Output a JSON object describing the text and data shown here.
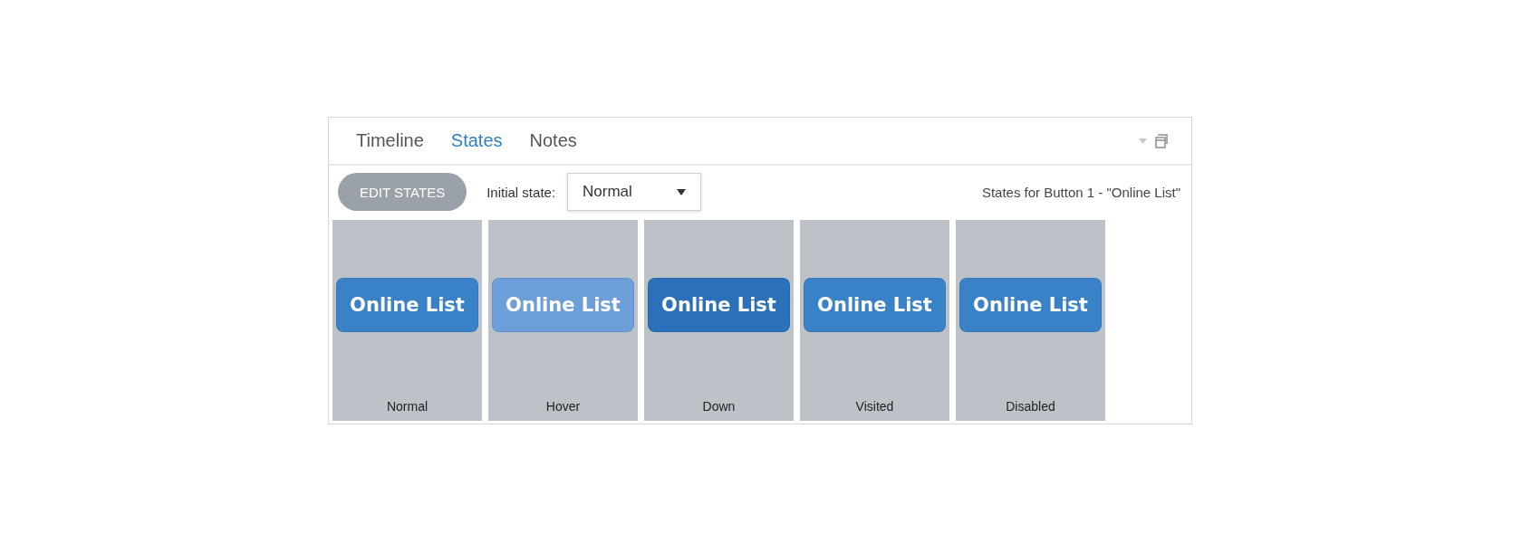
{
  "tabs": [
    {
      "label": "Timeline",
      "selected": false
    },
    {
      "label": "States",
      "selected": true
    },
    {
      "label": "Notes",
      "selected": false
    }
  ],
  "toolbar": {
    "edit_button": "EDIT STATES",
    "initial_state_label": "Initial state:",
    "initial_state_value": "Normal",
    "caption": "States for Button 1 - \"Online List\""
  },
  "states": [
    {
      "button_label": "Online List",
      "name": "Normal",
      "color": "#3a82c8"
    },
    {
      "button_label": "Online List",
      "name": "Hover",
      "color": "#6c9fd9"
    },
    {
      "button_label": "Online List",
      "name": "Down",
      "color": "#2b70b9"
    },
    {
      "button_label": "Online List",
      "name": "Visited",
      "color": "#3a82c8"
    },
    {
      "button_label": "Online List",
      "name": "Disabled",
      "color": "#3a82c8"
    }
  ]
}
